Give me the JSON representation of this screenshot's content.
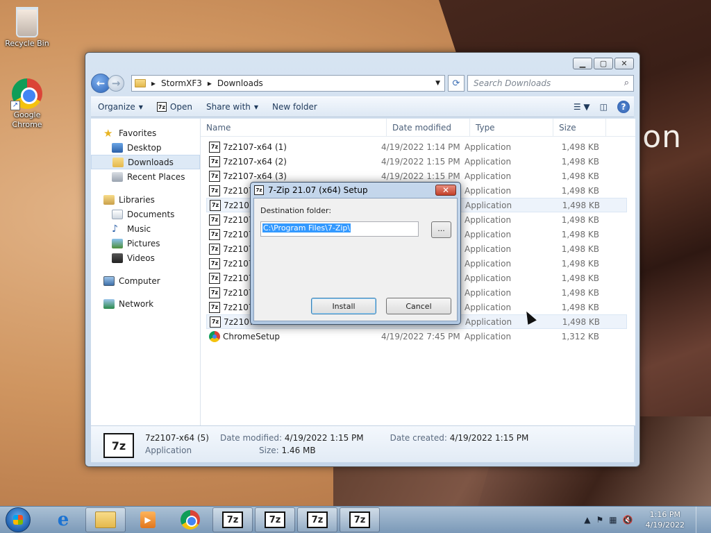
{
  "desktop": {
    "background_word": "ion",
    "icons": [
      {
        "label": "Recycle Bin",
        "icon": "recycle-bin-icon"
      },
      {
        "label": "Google Chrome",
        "icon": "chrome-icon"
      }
    ]
  },
  "explorer": {
    "breadcrumb": [
      "StormXF3",
      "Downloads"
    ],
    "search_placeholder": "Search Downloads",
    "toolbar": {
      "organize": "Organize",
      "open": "Open",
      "share_with": "Share with",
      "new_folder": "New folder"
    },
    "nav": {
      "favorites": "Favorites",
      "desktop": "Desktop",
      "downloads": "Downloads",
      "recent_places": "Recent Places",
      "libraries": "Libraries",
      "documents": "Documents",
      "music": "Music",
      "pictures": "Pictures",
      "videos": "Videos",
      "computer": "Computer",
      "network": "Network"
    },
    "columns": {
      "name": "Name",
      "date": "Date modified",
      "type": "Type",
      "size": "Size"
    },
    "files": [
      {
        "name": "7z2107-x64 (1)",
        "date": "4/19/2022 1:14 PM",
        "type": "Application",
        "size": "1,498 KB"
      },
      {
        "name": "7z2107-x64 (2)",
        "date": "4/19/2022 1:15 PM",
        "type": "Application",
        "size": "1,498 KB"
      },
      {
        "name": "7z2107-x64 (3)",
        "date": "4/19/2022 1:15 PM",
        "type": "Application",
        "size": "1,498 KB"
      },
      {
        "name": "7z2107",
        "date": "",
        "type": "Application",
        "size": "1,498 KB"
      },
      {
        "name": "7z2107",
        "date": "",
        "type": "Application",
        "size": "1,498 KB"
      },
      {
        "name": "7z2107",
        "date": "",
        "type": "Application",
        "size": "1,498 KB"
      },
      {
        "name": "7z2107",
        "date": "",
        "type": "Application",
        "size": "1,498 KB"
      },
      {
        "name": "7z2107",
        "date": "",
        "type": "Application",
        "size": "1,498 KB"
      },
      {
        "name": "7z2107",
        "date": "",
        "type": "Application",
        "size": "1,498 KB"
      },
      {
        "name": "7z2107",
        "date": "",
        "type": "Application",
        "size": "1,498 KB"
      },
      {
        "name": "7z2107",
        "date": "",
        "type": "Application",
        "size": "1,498 KB"
      },
      {
        "name": "7z2107",
        "date": "",
        "type": "Application",
        "size": "1,498 KB"
      },
      {
        "name": "7z2107",
        "date": "",
        "type": "Application",
        "size": "1,498 KB"
      },
      {
        "name": "ChromeSetup",
        "date": "4/19/2022 7:45 PM",
        "type": "Application",
        "size": "1,312 KB"
      }
    ],
    "details": {
      "name": "7z2107-x64 (5)",
      "kind": "Application",
      "date_modified_label": "Date modified:",
      "date_modified": "4/19/2022 1:15 PM",
      "size_label": "Size:",
      "size": "1.46 MB",
      "date_created_label": "Date created:",
      "date_created": "4/19/2022 1:15 PM"
    }
  },
  "dialog": {
    "title": "7-Zip 21.07 (x64) Setup",
    "dest_label": "Destination folder:",
    "dest_value": "C:\\Program Files\\7-Zip\\",
    "browse": "...",
    "install": "Install",
    "cancel": "Cancel"
  },
  "taskbar": {
    "time": "1:16 PM",
    "date": "4/19/2022"
  }
}
